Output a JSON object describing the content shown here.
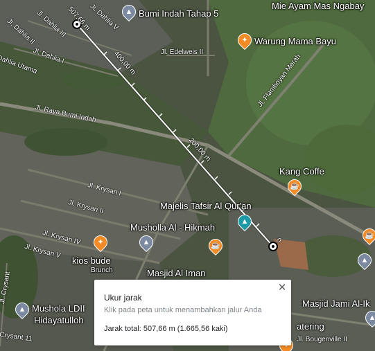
{
  "map": {
    "roads": [
      {
        "id": "dahlia-v",
        "text": "Jl. Dahlia V"
      },
      {
        "id": "dahlia-ii",
        "text": "Jl. Dahlia II"
      },
      {
        "id": "dahlia-iii",
        "text": "Jl. Dahlia III"
      },
      {
        "id": "dahlia-i",
        "text": "Jl. Dahlia I"
      },
      {
        "id": "dahlia-utama",
        "text": "Dahlia Utama"
      },
      {
        "id": "edelweis-ii",
        "text": "Jl. Edelweis II"
      },
      {
        "id": "flamboyan-merah",
        "text": "Jl. Flamboyan Merah"
      },
      {
        "id": "raya-bumi-indah",
        "text": "Jl. Raya Bumi Indah"
      },
      {
        "id": "krysan-i",
        "text": "Jl. Krysan I"
      },
      {
        "id": "krysan-ii",
        "text": "Jl. Krysan II"
      },
      {
        "id": "krysan-iv",
        "text": "Jl. Krysan IV"
      },
      {
        "id": "krysan-v",
        "text": "Jl. Krysan V"
      },
      {
        "id": "crysant",
        "text": "Jl. Crysant"
      },
      {
        "id": "crysant-11",
        "text": "Crysant 11"
      },
      {
        "id": "bougenville-ii",
        "text": "Jl. Bougenville II"
      }
    ],
    "places": [
      {
        "id": "bumi-indah-tahap-5",
        "text": "Bumi Indah Tahap 5",
        "icon": "landmark-icon"
      },
      {
        "id": "mie-ayam-mas-ngabay",
        "text": "Mie Ayam Mas Ngabay",
        "icon": "none"
      },
      {
        "id": "warung-mama-bayu",
        "text": "Warung Mama Bayu",
        "icon": "restaurant-icon"
      },
      {
        "id": "kang-coffe",
        "text": "Kang Coffe",
        "icon": "cafe-icon"
      },
      {
        "id": "majelis-tafsir",
        "text": "Majelis Tafsir Al Qur'an",
        "icon": "landmark-icon"
      },
      {
        "id": "musholla-al-hikmah",
        "text": "Musholla Al - Hikmah",
        "icon": "none"
      },
      {
        "id": "kios-bude",
        "text": "kios bude",
        "icon": "restaurant-icon"
      },
      {
        "id": "brunch",
        "text": "Brunch",
        "icon": "none"
      },
      {
        "id": "masjid-al-iman",
        "text": "Masjid Al Iman",
        "icon": "none"
      },
      {
        "id": "mushola-ldii",
        "text": "Mushola LDII",
        "icon": "mosque-icon"
      },
      {
        "id": "hidayatulloh",
        "text": "Hidayatulloh",
        "icon": "none"
      },
      {
        "id": "masjid-jami",
        "text": "Masjid Jami Al-Ik",
        "icon": "none"
      },
      {
        "id": "catering",
        "text": "atering",
        "icon": "none"
      }
    ],
    "measure": {
      "label_start": "507,66 m",
      "label_400": "400,00 m",
      "label_200": "200,00 m",
      "label_end": "0"
    },
    "colors": {
      "line": "#ffffff",
      "restaurant_pin": "#f28b26",
      "landmark_pin": "#1e9aa6",
      "mosque_pin": "#7b8aa0"
    }
  },
  "panel": {
    "title": "Ukur jarak",
    "hint": "Klik pada peta untuk menambahkan jalur Anda",
    "total": "Jarak total: 507,66 m (1.665,56 kaki)",
    "close_icon": "close-icon"
  }
}
